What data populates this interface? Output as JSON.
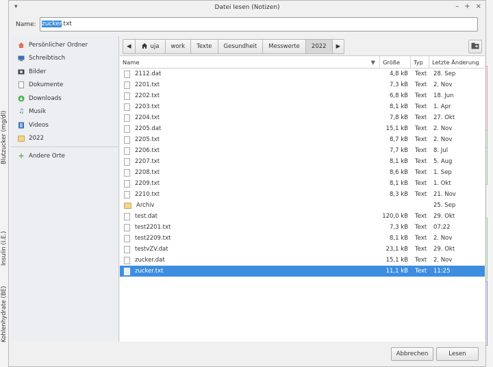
{
  "background": {
    "labels": [
      "Blutzucker (mg/dl)",
      "Insulin (I.E.)",
      "Kohlenhydrate (BE)"
    ]
  },
  "dialog": {
    "title": "Datei lesen (Notizen)",
    "name_label": "Name:",
    "filename_selected": "zucker",
    "filename_rest": ".txt"
  },
  "sidebar": {
    "items": [
      {
        "label": "Persönlicher Ordner",
        "icon": "home-icon"
      },
      {
        "label": "Schreibtisch",
        "icon": "desktop-icon"
      },
      {
        "label": "Bilder",
        "icon": "pictures-icon"
      },
      {
        "label": "Dokumente",
        "icon": "document-icon"
      },
      {
        "label": "Downloads",
        "icon": "download-icon"
      },
      {
        "label": "Musik",
        "icon": "music-icon"
      },
      {
        "label": "Videos",
        "icon": "video-icon"
      },
      {
        "label": "2022",
        "icon": "folder-icon"
      }
    ],
    "other": {
      "label": "Andere Orte",
      "icon": "plus-icon"
    }
  },
  "pathbar": {
    "segments": [
      "uja",
      "work",
      "Texte",
      "Gesundheit",
      "Messwerte",
      "2022"
    ],
    "active": "2022"
  },
  "columns": {
    "name": "Name",
    "size": "Größe",
    "type": "Typ",
    "date": "Letzte Änderung"
  },
  "files": [
    {
      "name": "2112.dat",
      "size": "4,8 kB",
      "type": "Text",
      "date": "28. Sep",
      "kind": "file"
    },
    {
      "name": "2201.txt",
      "size": "7,3 kB",
      "type": "Text",
      "date": "2. Nov",
      "kind": "file"
    },
    {
      "name": "2202.txt",
      "size": "6,8 kB",
      "type": "Text",
      "date": "18. Jun",
      "kind": "file"
    },
    {
      "name": "2203.txt",
      "size": "8,1 kB",
      "type": "Text",
      "date": "1. Apr",
      "kind": "file"
    },
    {
      "name": "2204.txt",
      "size": "7,8 kB",
      "type": "Text",
      "date": "27. Okt",
      "kind": "file"
    },
    {
      "name": "2205.dat",
      "size": "15,1 kB",
      "type": "Text",
      "date": "2. Nov",
      "kind": "file"
    },
    {
      "name": "2205.txt",
      "size": "8,7 kB",
      "type": "Text",
      "date": "2. Nov",
      "kind": "file"
    },
    {
      "name": "2206.txt",
      "size": "7,7 kB",
      "type": "Text",
      "date": "8. Jul",
      "kind": "file"
    },
    {
      "name": "2207.txt",
      "size": "8,1 kB",
      "type": "Text",
      "date": "5. Aug",
      "kind": "file"
    },
    {
      "name": "2208.txt",
      "size": "8,6 kB",
      "type": "Text",
      "date": "1. Sep",
      "kind": "file"
    },
    {
      "name": "2209.txt",
      "size": "8,1 kB",
      "type": "Text",
      "date": "1. Okt",
      "kind": "file"
    },
    {
      "name": "2210.txt",
      "size": "8,3 kB",
      "type": "Text",
      "date": "21. Nov",
      "kind": "file"
    },
    {
      "name": "Archiv",
      "size": "",
      "type": "",
      "date": "25. Sep",
      "kind": "folder"
    },
    {
      "name": "test.dat",
      "size": "120,0 kB",
      "type": "Text",
      "date": "29. Okt",
      "kind": "file"
    },
    {
      "name": "test2201.txt",
      "size": "7,3 kB",
      "type": "Text",
      "date": "07:22",
      "kind": "file"
    },
    {
      "name": "test2209.txt",
      "size": "8,1 kB",
      "type": "Text",
      "date": "2. Nov",
      "kind": "file"
    },
    {
      "name": "testvZV.dat",
      "size": "23,1 kB",
      "type": "Text",
      "date": "29. Okt",
      "kind": "file"
    },
    {
      "name": "zucker.dat",
      "size": "15,1 kB",
      "type": "Text",
      "date": "2. Nov",
      "kind": "file"
    },
    {
      "name": "zucker.txt",
      "size": "11,1 kB",
      "type": "Text",
      "date": "11:25",
      "kind": "file",
      "selected": true
    }
  ],
  "buttons": {
    "cancel": "Abbrechen",
    "open": "Lesen"
  },
  "colors": {
    "selection": "#3d8ee0",
    "folder": "#f3d58e"
  }
}
